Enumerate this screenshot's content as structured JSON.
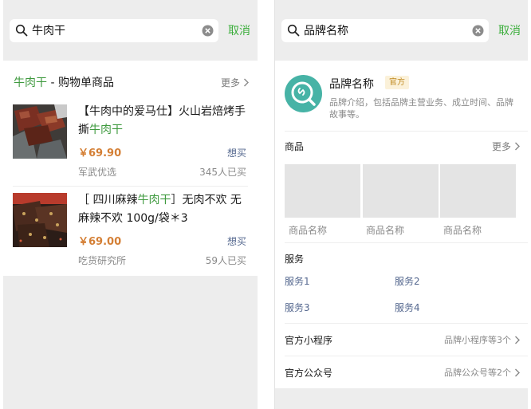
{
  "left": {
    "search": {
      "query": "牛肉干",
      "cancel": "取消"
    },
    "section": {
      "keyword": "牛肉干",
      "title_rest": " - 购物单商品",
      "more": "更多"
    },
    "products": [
      {
        "title_before": "【牛肉中的爱马仕】火山岩焙烤手撕",
        "title_highlight": "牛肉干",
        "title_after": "",
        "price": "￥69.90",
        "want": "想买",
        "seller": "军武优选",
        "buyers": "345人已买"
      },
      {
        "title_before": "［ 四川麻辣",
        "title_highlight": "牛肉干",
        "title_after": "］无肉不欢 无麻辣不欢 100g/袋＊3",
        "price": "￥69.00",
        "want": "想买",
        "seller": "吃货研究所",
        "buyers": "59人已买"
      }
    ]
  },
  "right": {
    "search": {
      "query": "品牌名称",
      "cancel": "取消"
    },
    "brand": {
      "name": "品牌名称",
      "badge": "官方",
      "description": "品牌介绍，包括品牌主营业务、成立时间、品牌故事等。"
    },
    "goods": {
      "title": "商品",
      "more": "更多",
      "items": [
        "商品名称",
        "商品名称",
        "商品名称"
      ]
    },
    "services": {
      "title": "服务",
      "items": [
        "服务1",
        "服务2",
        "服务3",
        "服务4"
      ]
    },
    "mini_program": {
      "title": "官方小程序",
      "meta": "品牌小程序等3个"
    },
    "official_account": {
      "title": "官方公众号",
      "meta": "品牌公众号等2个"
    }
  },
  "colors": {
    "accent_green": "#3cae3c",
    "price_orange": "#d47f35",
    "link_blue": "#55688f",
    "brand_teal": "#47b3a6"
  }
}
